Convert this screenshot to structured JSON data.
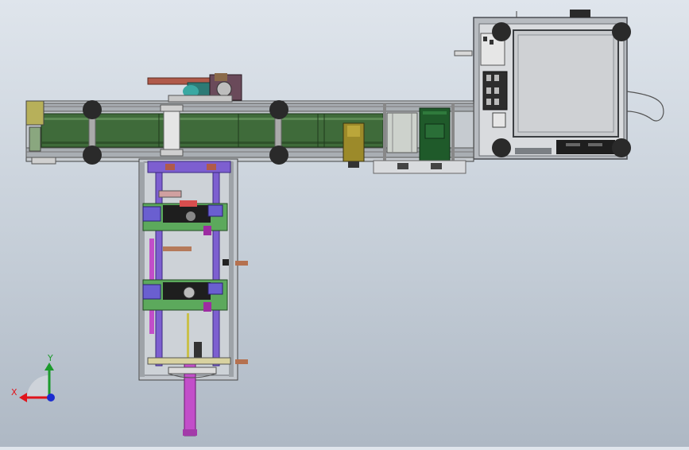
{
  "viewport": {
    "background_top": "#dfe5ec",
    "background_bottom": "#aeb8c4"
  },
  "triad": {
    "x_label": "X",
    "y_label": "Y",
    "x_color": "#e0141c",
    "y_color": "#1c9a2c",
    "z_color": "#1c2cd0"
  },
  "colors": {
    "frame_gray": "#9aa0a6",
    "belt_green": "#3f6b3a",
    "bolt_black": "#2a2a2a",
    "violet": "#7d5fd0",
    "magenta": "#c24ec9",
    "cabinet": "#8f949a",
    "screen": "#c8cacd"
  }
}
